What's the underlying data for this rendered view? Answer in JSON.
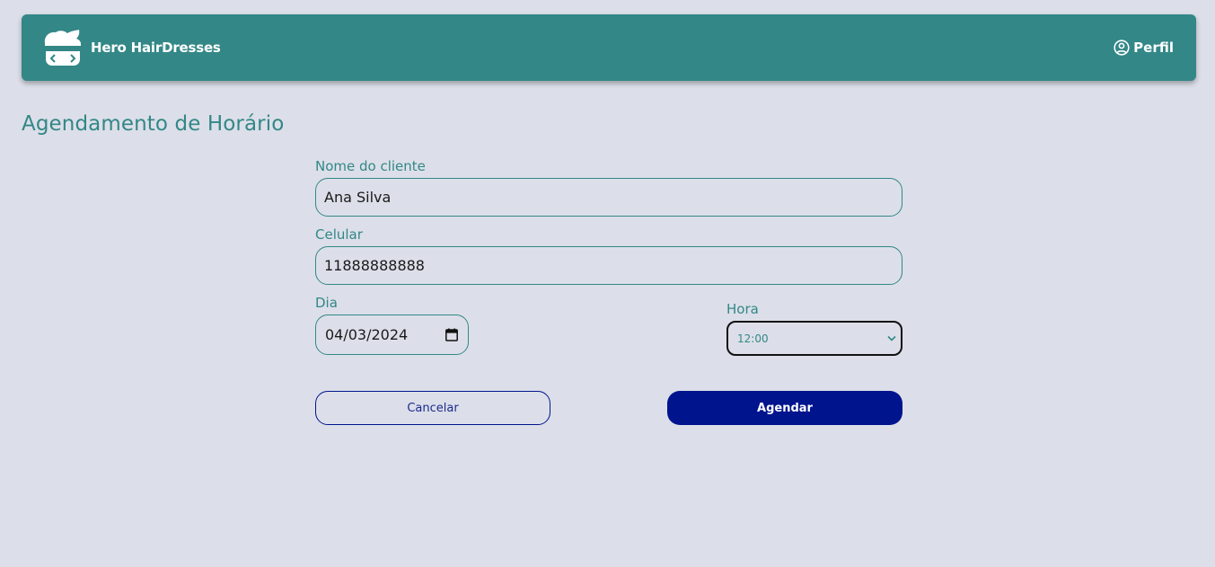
{
  "navbar": {
    "brand_name": "Hero HairDresses",
    "logo_icon": "hero-hairdresser-logo-icon",
    "profile_icon": "user-circle-icon",
    "profile_label": "Perfil",
    "color": "#338787"
  },
  "page": {
    "title": "Agendamento de Horário"
  },
  "form": {
    "client_name": {
      "label": "Nome do cliente",
      "value": "Ana Silva"
    },
    "phone": {
      "label": "Celular",
      "value": "11888888888"
    },
    "day": {
      "label": "Dia",
      "value": "04/03/2024",
      "icon": "calendar-icon"
    },
    "hour": {
      "label": "Hora",
      "selected": "12:00",
      "icon": "chevron-down-icon"
    },
    "cancel_label": "Cancelar",
    "submit_label": "Agendar"
  },
  "colors": {
    "background": "#dcdfe9",
    "accent": "#338787",
    "primary_button": "#00148e"
  }
}
